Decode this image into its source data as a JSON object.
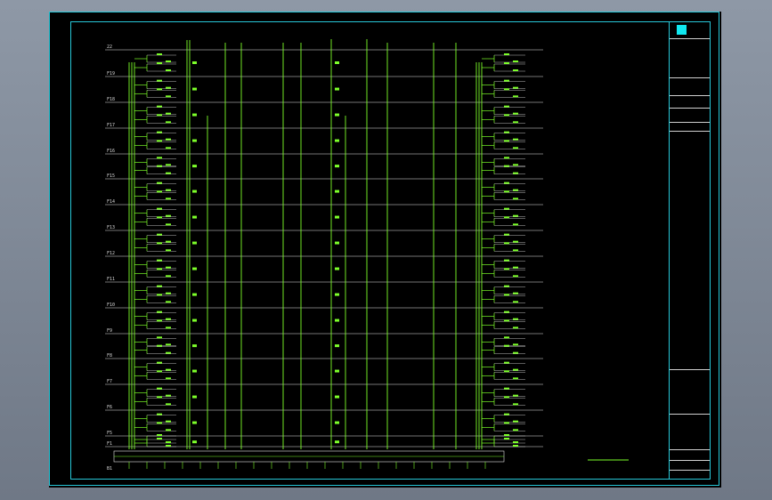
{
  "drawing": {
    "floors": [
      "22",
      "F19",
      "F18",
      "F17",
      "F16",
      "F15",
      "F14",
      "F13",
      "F12",
      "F11",
      "F10",
      "F9",
      "F8",
      "F7",
      "F6",
      "F5",
      "F1",
      "B1"
    ]
  },
  "colors": {
    "background": "#000000",
    "frame": "#27c7d8",
    "riser": "#7dff2a",
    "floor_line": "#e6e6e6",
    "text": "#cfcfcf"
  },
  "title_block": {
    "logo_icon": "square-logo-icon"
  }
}
